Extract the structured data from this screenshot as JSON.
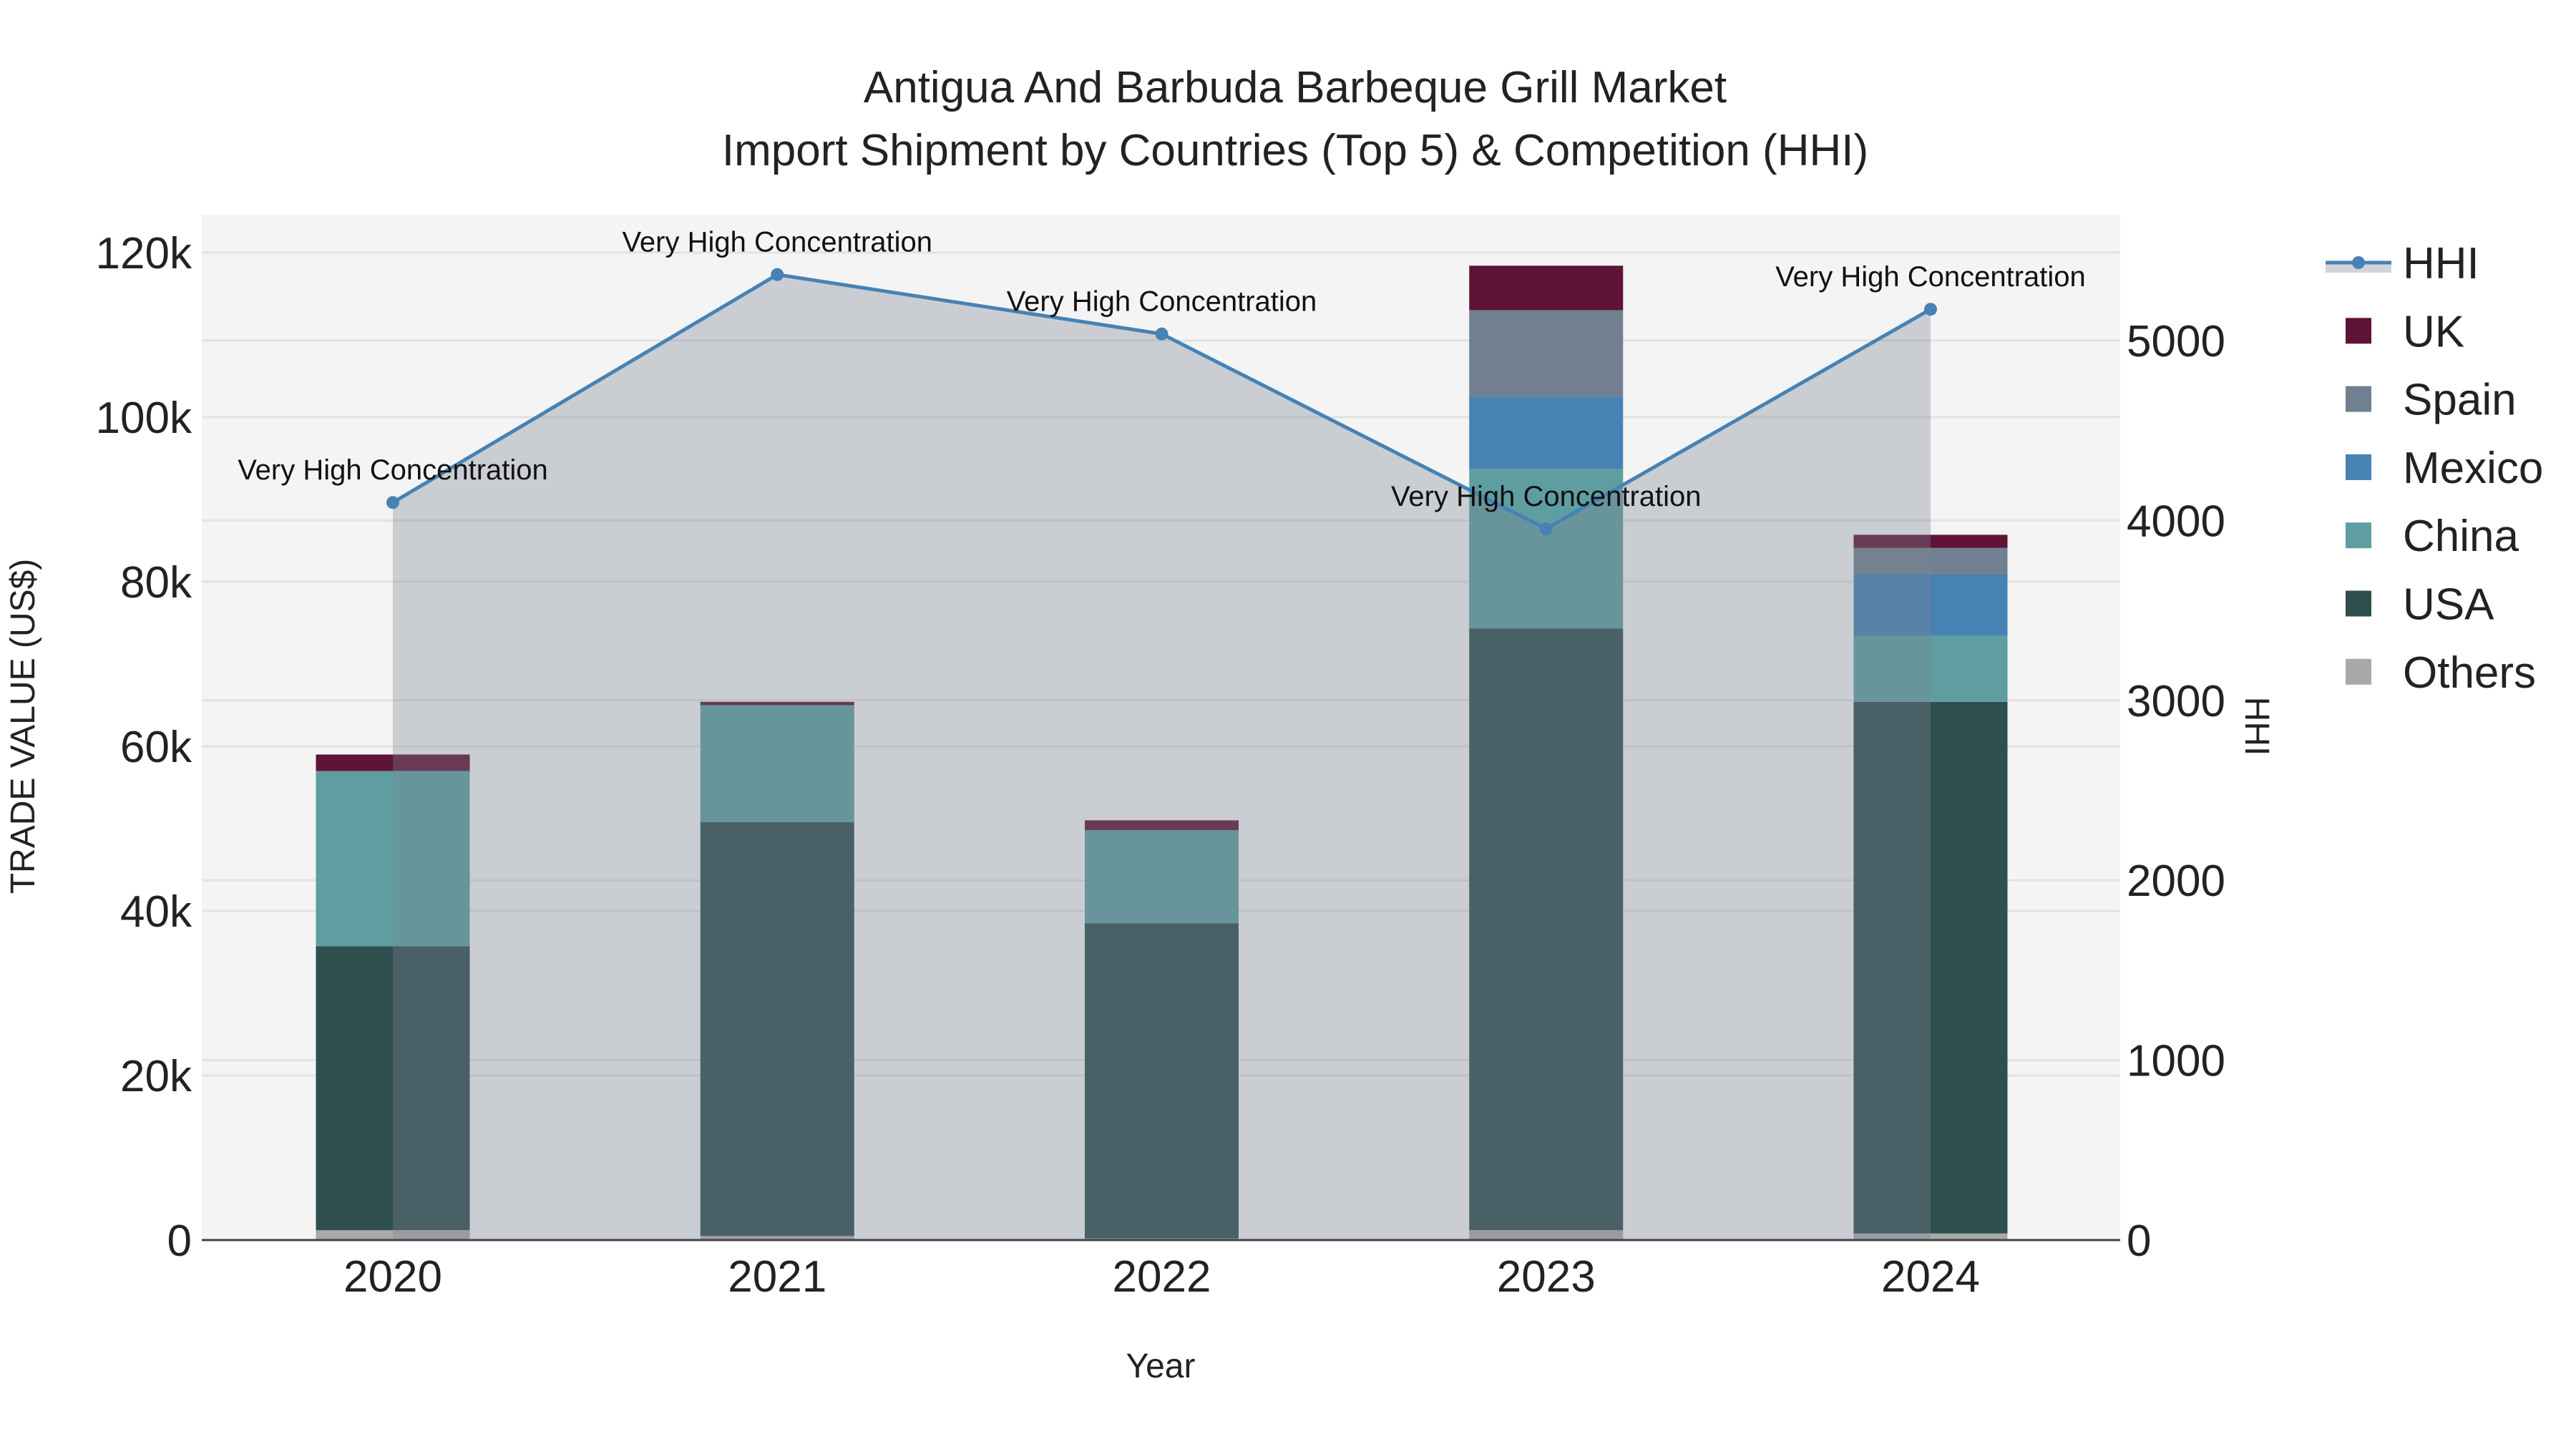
{
  "chart_data": {
    "type": "bar",
    "title": "Antigua And Barbuda Barbeque Grill Market",
    "subtitle": "Import Shipment by Countries (Top 5) & Competition (HHI)",
    "xlabel": "Year",
    "ylabel": "TRADE VALUE (US$)",
    "y2label": "HHI",
    "categories": [
      "2020",
      "2021",
      "2022",
      "2023",
      "2024"
    ],
    "ylim": [
      0,
      124600
    ],
    "y2lim": [
      0,
      5700
    ],
    "yticks": [
      0,
      20000,
      40000,
      60000,
      80000,
      100000,
      120000
    ],
    "ytick_labels": [
      "0",
      "20k",
      "40k",
      "60k",
      "80k",
      "100k",
      "120k"
    ],
    "y2ticks": [
      0,
      1000,
      2000,
      3000,
      4000,
      5000
    ],
    "y2tick_labels": [
      "0",
      "1000",
      "2000",
      "3000",
      "4000",
      "5000"
    ],
    "grid": true,
    "legend_position": "right",
    "series": [
      {
        "name": "Others",
        "color": "#a9a9a9",
        "values": [
          1200,
          500,
          200,
          1200,
          800
        ]
      },
      {
        "name": "USA",
        "color": "#2f4f4f",
        "values": [
          34500,
          50300,
          38300,
          73100,
          64600
        ]
      },
      {
        "name": "China",
        "color": "#5f9ea0",
        "values": [
          21300,
          14200,
          11300,
          19400,
          8000
        ]
      },
      {
        "name": "Mexico",
        "color": "#4682b4",
        "values": [
          0,
          0,
          0,
          8800,
          7500
        ]
      },
      {
        "name": "Spain",
        "color": "#708090",
        "values": [
          0,
          0,
          0,
          10500,
          3200
        ]
      },
      {
        "name": "UK",
        "color": "#5f1336",
        "values": [
          2000,
          400,
          1200,
          5400,
          1600
        ]
      }
    ],
    "hhi": {
      "name": "HHI",
      "color": "#4682b4",
      "values": [
        4100,
        5367,
        5037,
        3954,
        5174
      ],
      "annotations": [
        "Very High Concentration",
        "Very High Concentration",
        "Very High Concentration",
        "Very High Concentration",
        "Very High Concentration"
      ]
    },
    "legend_order": [
      "HHI",
      "UK",
      "Spain",
      "Mexico",
      "China",
      "USA",
      "Others"
    ]
  }
}
